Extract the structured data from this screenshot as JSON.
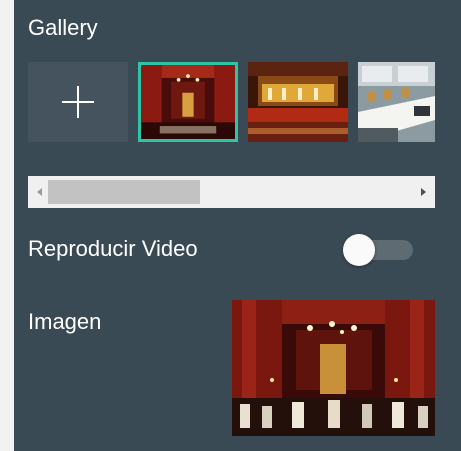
{
  "gallery": {
    "title": "Gallery",
    "add_icon": "plus-icon",
    "thumbnails": [
      {
        "name": "thumbnail-theatre-curtain",
        "selected": true
      },
      {
        "name": "thumbnail-theatre-stage",
        "selected": false
      },
      {
        "name": "thumbnail-conference-room",
        "selected": false
      }
    ],
    "selected_border_color": "#2ec4a6"
  },
  "scrollbar": {
    "left_arrow_icon": "arrow-left-icon",
    "right_arrow_icon": "arrow-right-icon"
  },
  "video": {
    "label": "Reproducir Video",
    "enabled": false
  },
  "image": {
    "label": "Imagen"
  },
  "colors": {
    "panel_background": "#3a4a55",
    "add_tile_background": "#44535e",
    "text": "#ffffff"
  }
}
